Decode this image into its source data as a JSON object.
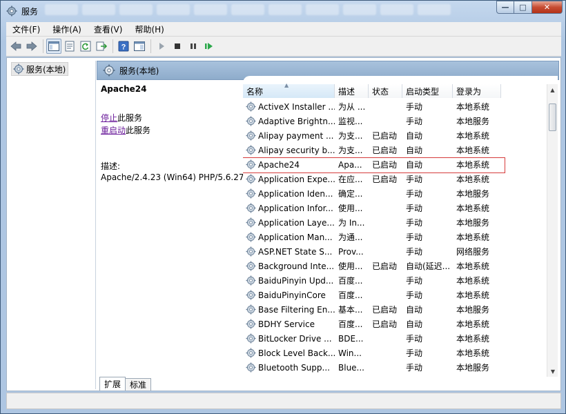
{
  "window": {
    "title": "服务",
    "buttons": {
      "minimize": "—",
      "maximize": "□",
      "close": "✕"
    }
  },
  "menu": [
    "文件(F)",
    "操作(A)",
    "查看(V)",
    "帮助(H)"
  ],
  "toolbar": {
    "icons": [
      "back-arrow-icon",
      "forward-arrow-icon",
      "console-tree-icon",
      "properties-icon",
      "refresh-icon",
      "export-list-icon",
      "help-icon",
      "show-hide-icon",
      "start-service-icon",
      "stop-service-icon",
      "pause-service-icon",
      "restart-service-icon"
    ]
  },
  "tree": {
    "root_label": "服务(本地)"
  },
  "pane": {
    "header": "服务(本地)"
  },
  "detail": {
    "service_name": "Apache24",
    "stop_link": "停止",
    "stop_suffix": "此服务",
    "restart_link": "重启动",
    "restart_suffix": "此服务",
    "description_label": "描述:",
    "description_text": "Apache/2.4.23 (Win64) PHP/5.6.27"
  },
  "list": {
    "columns": [
      "名称",
      "描述",
      "状态",
      "启动类型",
      "登录为"
    ],
    "rows": [
      {
        "name": "ActiveX Installer ...",
        "desc": "为从 ...",
        "status": "",
        "startup": "手动",
        "logon": "本地系统"
      },
      {
        "name": "Adaptive Brightn...",
        "desc": "监视...",
        "status": "",
        "startup": "手动",
        "logon": "本地服务"
      },
      {
        "name": "Alipay payment ...",
        "desc": "为支...",
        "status": "已启动",
        "startup": "自动",
        "logon": "本地系统"
      },
      {
        "name": "Alipay security b...",
        "desc": "为支...",
        "status": "已启动",
        "startup": "自动",
        "logon": "本地系统"
      },
      {
        "name": "Apache24",
        "desc": "Apa...",
        "status": "已启动",
        "startup": "自动",
        "logon": "本地系统"
      },
      {
        "name": "Application Expe...",
        "desc": "在应...",
        "status": "已启动",
        "startup": "手动",
        "logon": "本地系统"
      },
      {
        "name": "Application Iden...",
        "desc": "确定...",
        "status": "",
        "startup": "手动",
        "logon": "本地服务"
      },
      {
        "name": "Application Infor...",
        "desc": "使用...",
        "status": "",
        "startup": "手动",
        "logon": "本地系统"
      },
      {
        "name": "Application Laye...",
        "desc": "为 In...",
        "status": "",
        "startup": "手动",
        "logon": "本地服务"
      },
      {
        "name": "Application Man...",
        "desc": "为通...",
        "status": "",
        "startup": "手动",
        "logon": "本地系统"
      },
      {
        "name": "ASP.NET State S...",
        "desc": "Prov...",
        "status": "",
        "startup": "手动",
        "logon": "网络服务"
      },
      {
        "name": "Background Inte...",
        "desc": "使用...",
        "status": "已启动",
        "startup": "自动(延迟...",
        "logon": "本地系统"
      },
      {
        "name": "BaiduPinyin Upd...",
        "desc": "百度...",
        "status": "",
        "startup": "手动",
        "logon": "本地系统"
      },
      {
        "name": "BaiduPinyinCore",
        "desc": "百度...",
        "status": "",
        "startup": "手动",
        "logon": "本地系统"
      },
      {
        "name": "Base Filtering En...",
        "desc": "基本...",
        "status": "已启动",
        "startup": "自动",
        "logon": "本地服务"
      },
      {
        "name": "BDHY Service",
        "desc": "百度...",
        "status": "已启动",
        "startup": "自动",
        "logon": "本地系统"
      },
      {
        "name": "BitLocker Drive ...",
        "desc": "BDE...",
        "status": "",
        "startup": "手动",
        "logon": "本地系统"
      },
      {
        "name": "Block Level Back...",
        "desc": "Win...",
        "status": "",
        "startup": "手动",
        "logon": "本地系统"
      },
      {
        "name": "Bluetooth Supp...",
        "desc": "Blue...",
        "status": "",
        "startup": "手动",
        "logon": "本地服务"
      }
    ]
  },
  "tabs": [
    "扩展",
    "标准"
  ]
}
